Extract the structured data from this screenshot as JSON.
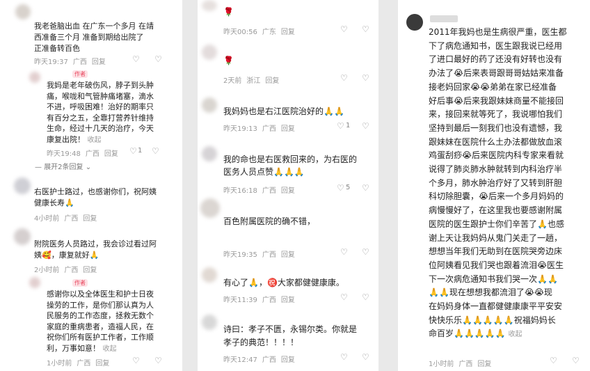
{
  "p1": {
    "c1": {
      "text": "我老爸脑出血 在广东一个多月  在靖\n西准备三个月  准备到期给出院了\n正准备转百色",
      "time": "昨天19:37",
      "loc": "广西",
      "reply": "回复"
    },
    "c2": {
      "badge": "作者",
      "text": "我妈是老年破伤风，脖子到头肿\n痛，喉咙和气管肿痛堵塞，滴水\n不进，呼吸困难！治好的期率只\n有百分之五，全靠打营养针维持\n生命，经过十几天的治疗，今天\n康复出院！",
      "fold": "收起",
      "time": "昨天19:48",
      "loc": "广西",
      "reply": "回复",
      "likes": "1"
    },
    "expand": "展开2条回复",
    "c3": {
      "text": "右医护士路过，也感谢你们，祝阿姨\n健康长寿🙏",
      "time": "4小时前",
      "loc": "广西",
      "reply": "回复"
    },
    "c4": {
      "text": "附院医务人员路过，我会诊过看过阿\n姨🥰，康复就好🙏",
      "time": "2小时前",
      "loc": "广西",
      "reply": "回复"
    },
    "c5": {
      "badge": "作者",
      "text": "感谢你以及全体医生和护士日夜\n操劳的工作，是你们那认真为人\n民服务的工作态度，拯救无数个\n家庭的重病患者，造福人民，在\n祝你们所有医护工作者，工作顺\n利，万事如意！",
      "fold": "收起",
      "time": "1小时前",
      "loc": "广西",
      "reply": "回复"
    }
  },
  "p2": {
    "c1": {
      "text": "🌹",
      "time": "昨天00:56",
      "loc": "广东",
      "reply": "回复"
    },
    "c2": {
      "text": "🌹",
      "time": "2天前",
      "loc": "浙江",
      "reply": "回复"
    },
    "c3": {
      "text": "我妈妈也是右江医院治好的🙏🙏",
      "time": "昨天19:13",
      "loc": "广西",
      "reply": "回复",
      "likes": "1"
    },
    "c4": {
      "text": "我的命也是右医救回来的，为右医的\n医务人员点赞🙏🙏🙏",
      "time": "昨天16:18",
      "loc": "广西",
      "reply": "回复",
      "likes": "5"
    },
    "c5": {
      "text": "百色附属医院的确不错，",
      "time": "昨天19:35",
      "loc": "广西",
      "reply": "回复"
    },
    "c6": {
      "text": "有心了🙏，㊗️大家都健健康康。",
      "time": "昨天11:39",
      "loc": "广西",
      "reply": "回复"
    },
    "c7": {
      "text": "诗曰：孝子不匮，永锡尔类。你就是\n孝子的典范！！！！",
      "time": "昨天12:47",
      "loc": "广西",
      "reply": "回复"
    }
  },
  "p3": {
    "c1": {
      "text": "2011年我妈也是生病很严重，医生都\n下了病危通知书，医生跟我说已经用\n了进口最好的药了还没有好转也没有\n办法了😭后来表哥跟哥哥姑姑来准备\n接老妈回家😭😭弟弟在家已经准备\n好后事😭后来我跟妹妹商量不能接回\n来，接回来就等死了，我说哪怕我们\n坚持到最后一刻我们也没有遗憾，我\n跟妹妹在医院什么土办法都做放血滚\n鸡蛋刮痧😭后来医院内科专家来看就\n说得了肺炎肺水肿就转到内科治疗半\n个多月，肺水肿治疗好了又转到肝胆\n科切除胆囊，😭后来一个多月妈妈的\n病慢慢好了，在这里我也要感谢附属\n医院的医生跟护士你们辛苦了🙏也感\n谢上天让我妈妈从鬼门关走了一趟，\n想想当年我们无助到在医院哭旁边床\n位阿姨看见我们哭也跟着流泪😭医生\n下一次病危通知书我们哭一次🙏🙏\n🙏🙏现在想想我都流泪了😭😭现\n在妈妈身体一直都健健康康平平安安\n快快乐乐🙏🙏🙏🙏🙏祝福妈妈长\n命百岁🙏🙏🙏🙏🙏",
      "fold": "收起",
      "time": "1小时前",
      "loc": "广西",
      "reply": "回复"
    }
  },
  "colors": {
    "bg": "#ffffff",
    "meta": "#9a9a9a",
    "badge_bg": "#fde2e6",
    "badge_text": "#e8435a"
  }
}
